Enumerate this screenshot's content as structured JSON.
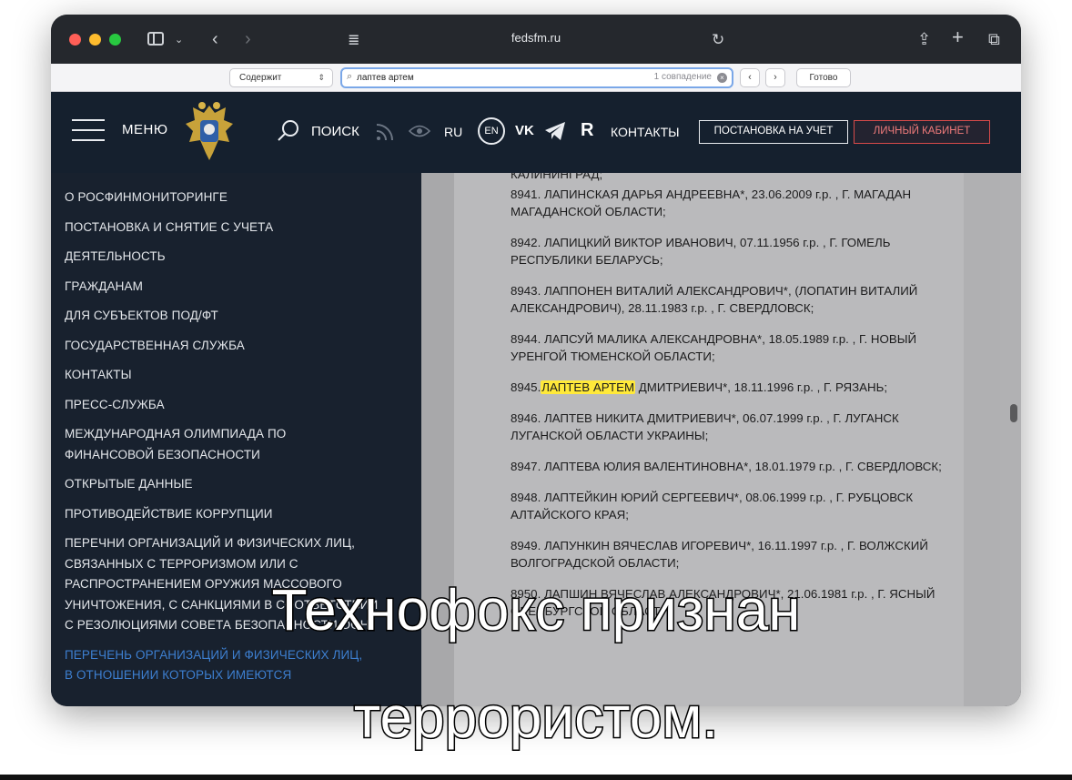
{
  "browser": {
    "url": "fedsfm.ru",
    "find_bar": {
      "scope": "Содержит",
      "query": "лаптев артем",
      "matches": "1 совпадение",
      "done": "Готово"
    }
  },
  "header": {
    "menu_label": "МЕНЮ",
    "search_label": "ПОИСК",
    "lang_ru": "RU",
    "lang_en": "EN",
    "vk": "VK",
    "r_icon": "R",
    "contacts": "КОНТАКТЫ",
    "register_button": "ПОСТАНОВКА НА УЧЕТ",
    "cabinet_button": "ЛИЧНЫЙ КАБИНЕТ"
  },
  "nav": {
    "items": [
      "О РОСФИНМОНИТОРИНГЕ",
      "ПОСТАНОВКА И СНЯТИЕ С УЧЕТА",
      "ДЕЯТЕЛЬНОСТЬ",
      "ГРАЖДАНАМ",
      "ДЛЯ СУБЪЕКТОВ ПОД/ФТ",
      "ГОСУДАРСТВЕННАЯ СЛУЖБА",
      "КОНТАКТЫ",
      "ПРЕСС-СЛУЖБА",
      "МЕЖДУНАРОДНАЯ ОЛИМПИАДА ПО ФИНАНСОВОЙ БЕЗОПАСНОСТИ",
      "ОТКРЫТЫЕ ДАННЫЕ",
      "ПРОТИВОДЕЙСТВИЕ КОРРУПЦИИ",
      "ПЕРЕЧНИ ОРГАНИЗАЦИЙ И ФИЗИЧЕСКИХ ЛИЦ, СВЯЗАННЫХ С ТЕРРОРИЗМОМ ИЛИ С РАСПРОСТРАНЕНИЕМ ОРУЖИЯ МАССОВОГО УНИЧТОЖЕНИЯ, С САНКЦИЯМИ В СООТВЕТСТВИИ С РЕЗОЛЮЦИЯМИ СОВЕТА БЕЗОПАСНОСТИ ООН"
    ],
    "active_item": "ПЕРЕЧЕНЬ ОРГАНИЗАЦИЙ И ФИЗИЧЕСКИХ ЛИЦ, В ОТНОШЕНИИ КОТОРЫХ ИМЕЮТСЯ"
  },
  "content": {
    "prev_fragment": "КАЛИНИНГРАД;",
    "entries": [
      {
        "pre": "8941. ЛАПИНСКАЯ ДАРЬЯ АНДРЕЕВНА*, 23.06.2009 г.р. , Г. МАГАДАН МАГАДАНСКОЙ ОБЛАСТИ;"
      },
      {
        "pre": "8942. ЛАПИЦКИЙ ВИКТОР ИВАНОВИЧ, 07.11.1956 г.р. , Г. ГОМЕЛЬ РЕСПУБЛИКИ БЕЛАРУСЬ;"
      },
      {
        "pre": "8943. ЛАППОНЕН ВИТАЛИЙ АЛЕКСАНДРОВИЧ*, (ЛОПАТИН ВИТАЛИЙ АЛЕКСАНДРОВИЧ), 28.11.1983 г.р. , Г. СВЕРДЛОВСК;"
      },
      {
        "pre": "8944. ЛАПСУЙ МАЛИКА АЛЕКСАНДРОВНА*, 18.05.1989 г.р. , Г. НОВЫЙ УРЕНГОЙ ТЮМЕНСКОЙ ОБЛАСТИ;"
      },
      {
        "pre": "8945.",
        "highlight": "ЛАПТЕВ АРТЕМ",
        "post": " ДМИТРИЕВИЧ*, 18.11.1996 г.р. , Г. РЯЗАНЬ;"
      },
      {
        "pre": "8946. ЛАПТЕВ НИКИТА ДМИТРИЕВИЧ*, 06.07.1999 г.р. , Г. ЛУГАНСК ЛУГАНСКОЙ ОБЛАСТИ УКРАИНЫ;"
      },
      {
        "pre": "8947. ЛАПТЕВА ЮЛИЯ ВАЛЕНТИНОВНА*, 18.01.1979 г.р. , Г. СВЕРДЛОВСК;"
      },
      {
        "pre": "8948. ЛАПТЕЙКИН ЮРИЙ СЕРГЕЕВИЧ*, 08.06.1999 г.р. , Г. РУБЦОВСК АЛТАЙСКОГО КРАЯ;"
      },
      {
        "pre": "8949. ЛАПУНКИН ВЯЧЕСЛАВ ИГОРЕВИЧ*, 16.11.1997 г.р. , Г. ВОЛЖСКИЙ ВОЛГОГРАДСКОЙ ОБЛАСТИ;"
      },
      {
        "pre": "8950. ЛАПШИН ВЯЧЕСЛАВ АЛЕКСАНДРОВИЧ*, 21.06.1981 г.р. , Г. ЯСНЫЙ ОРЕНБУРГСКОЙ ОБЛАСТИ;"
      }
    ]
  },
  "subtitle": {
    "line1": "Технофокс признан",
    "line2": "террористом."
  },
  "colors": {
    "header_bg": "#15202e",
    "nav_bg": "#18212e",
    "highlight": "#ffe93a",
    "cabinet_red": "#d84a4a",
    "active_nav_blue": "#3d7fd0"
  },
  "icons": [
    "sidebar-toggle-icon",
    "chevron-left-icon",
    "chevron-right-icon",
    "reader-icon",
    "reload-icon",
    "share-icon",
    "plus-icon",
    "tabs-icon",
    "search-icon",
    "rss-icon",
    "eye-icon",
    "vk-icon",
    "telegram-icon",
    "rutube-icon",
    "emblem-logo"
  ]
}
